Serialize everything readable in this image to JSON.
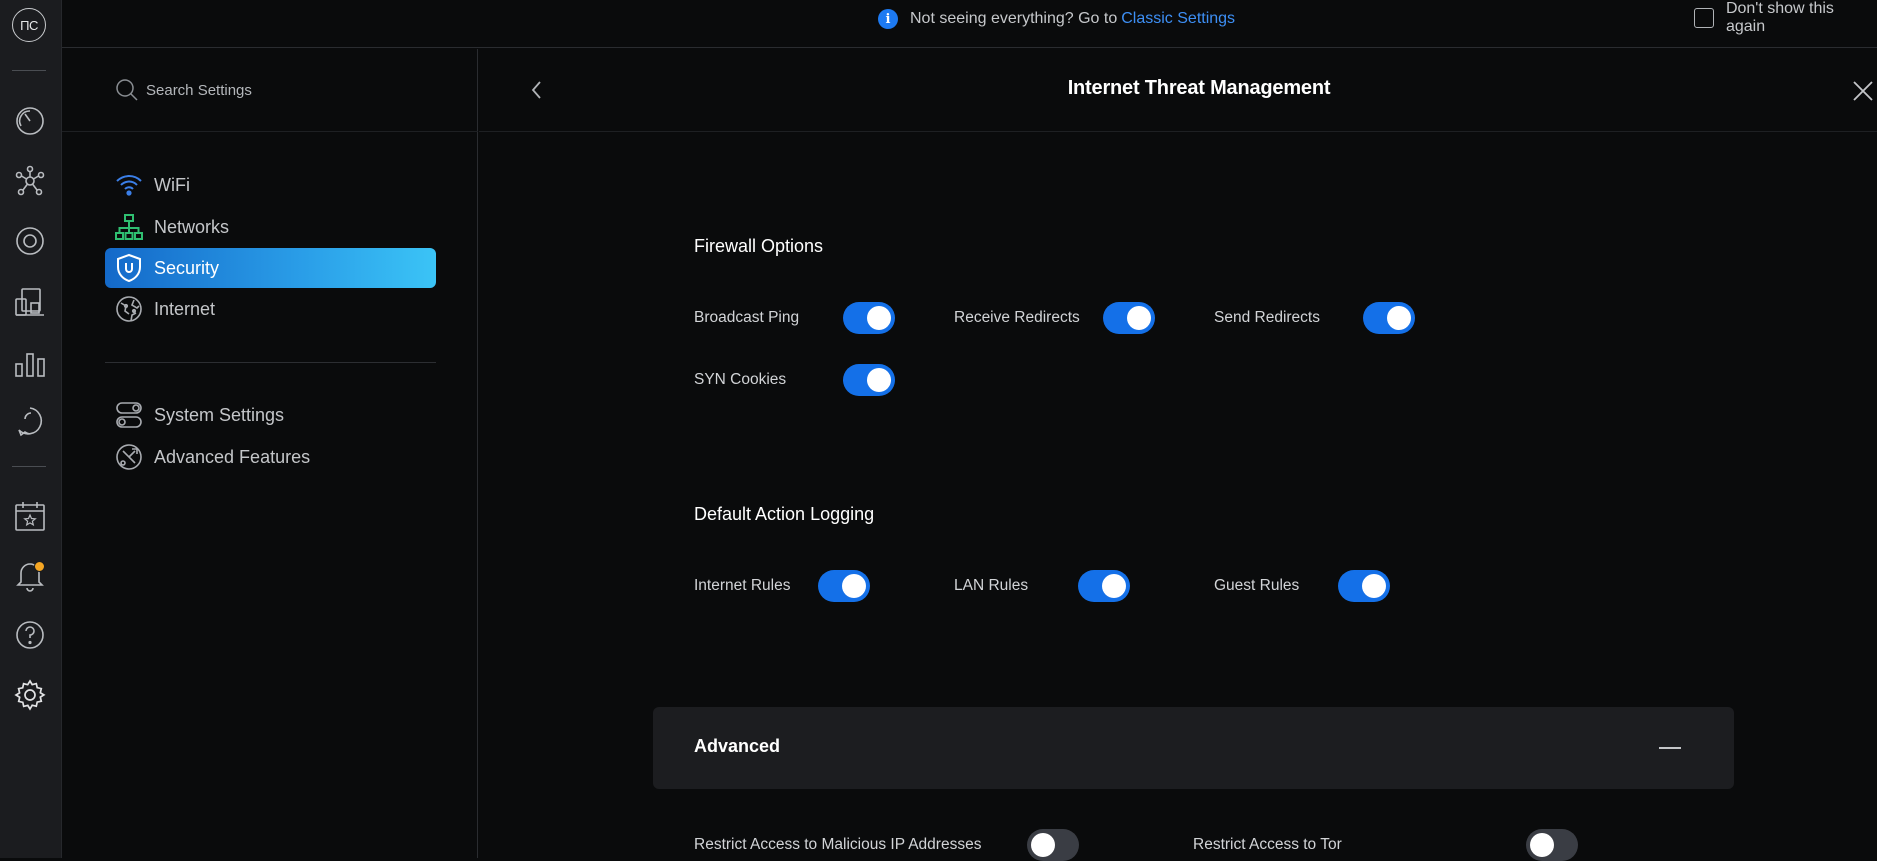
{
  "rail": {
    "avatar_initials": "ПС",
    "items": [
      {
        "name": "dashboard-icon"
      },
      {
        "name": "topology-icon"
      },
      {
        "name": "devices-icon"
      },
      {
        "name": "clients-icon"
      },
      {
        "name": "statistics-icon"
      },
      {
        "name": "insights-icon"
      },
      {
        "name": "events-icon"
      },
      {
        "name": "notifications-icon"
      },
      {
        "name": "help-icon"
      },
      {
        "name": "settings-icon"
      }
    ],
    "notification_dot_color": "#f5a623"
  },
  "banner": {
    "message": "Not seeing everything? Go to",
    "link": "Classic Settings",
    "checkbox_label": "Don't show this again"
  },
  "sidebar": {
    "search_placeholder": "Search Settings",
    "items": [
      {
        "label": "WiFi",
        "icon": "wifi-icon"
      },
      {
        "label": "Networks",
        "icon": "networks-icon"
      },
      {
        "label": "Security",
        "icon": "shield-icon",
        "active": true
      },
      {
        "label": "Internet",
        "icon": "globe-icon"
      }
    ],
    "secondary_items": [
      {
        "label": "System Settings",
        "icon": "toggles-icon"
      },
      {
        "label": "Advanced Features",
        "icon": "tools-icon"
      }
    ]
  },
  "main": {
    "title": "Internet Threat Management",
    "firewall": {
      "title": "Firewall Options",
      "options": [
        {
          "label": "Broadcast Ping",
          "on": true
        },
        {
          "label": "Receive Redirects",
          "on": true
        },
        {
          "label": "Send Redirects",
          "on": true
        },
        {
          "label": "SYN Cookies",
          "on": true
        }
      ]
    },
    "logging": {
      "title": "Default Action Logging",
      "options": [
        {
          "label": "Internet Rules",
          "on": true
        },
        {
          "label": "LAN Rules",
          "on": true
        },
        {
          "label": "Guest Rules",
          "on": true
        }
      ]
    },
    "advanced": {
      "title": "Advanced",
      "options": [
        {
          "label": "Restrict Access to Malicious IP Addresses",
          "on": false
        },
        {
          "label": "Restrict Access to Tor",
          "on": false
        }
      ]
    }
  },
  "colors": {
    "accent": "#1470e8",
    "link": "#3d8ff5",
    "active_gradient_start": "#1469c9",
    "active_gradient_end": "#3bc4f6"
  }
}
